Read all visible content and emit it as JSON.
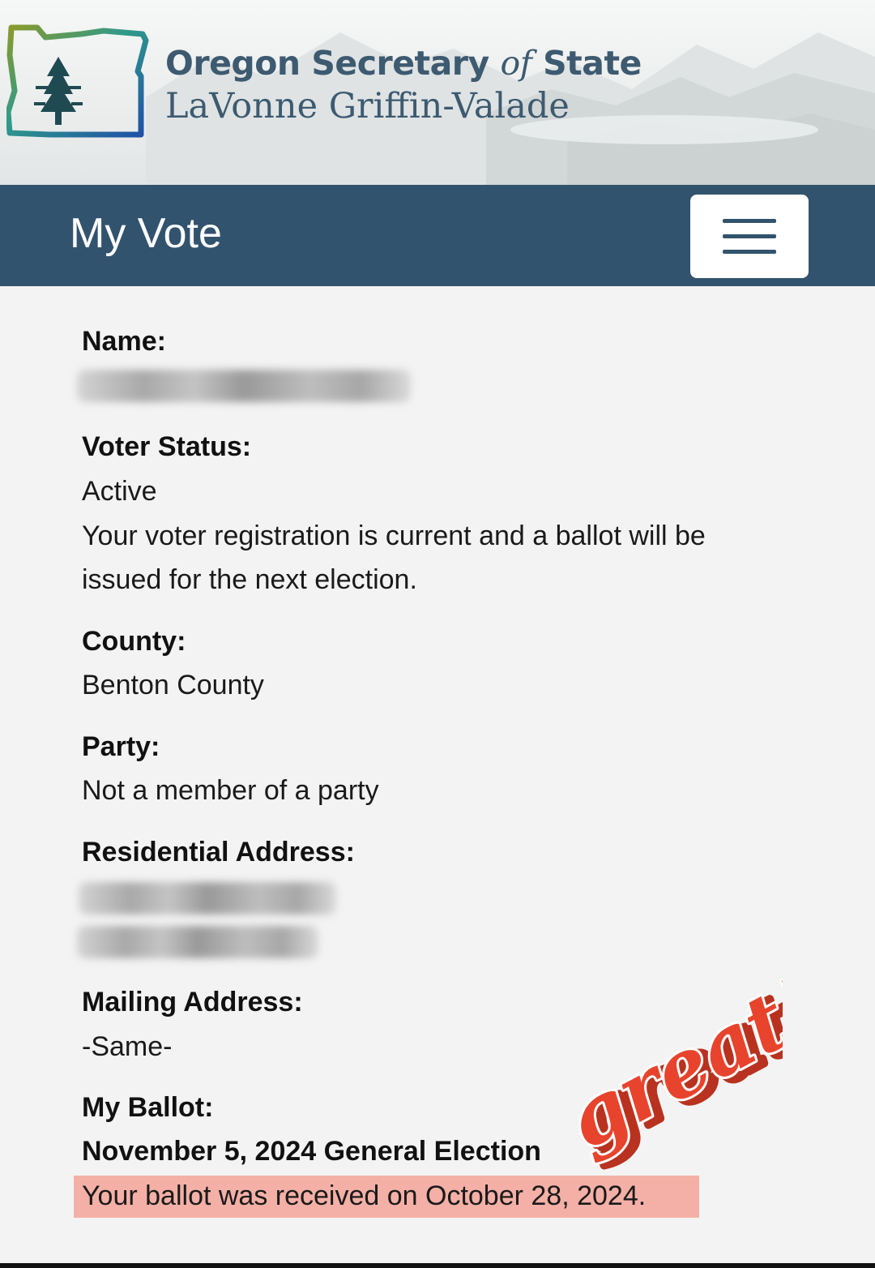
{
  "header": {
    "agency_main": "Oregon Secretary ",
    "agency_of": "of",
    "agency_end": " State",
    "official": "LaVonne Griffin-Valade",
    "logo_icon": "oregon-tree-logo-icon"
  },
  "navbar": {
    "title": "My Vote",
    "menu_icon": "hamburger-menu-icon"
  },
  "record": {
    "name_label": "Name:",
    "voter_status_label": "Voter Status:",
    "voter_status_value": "Active",
    "voter_status_desc_1": "Your voter registration is current and a ballot will be",
    "voter_status_desc_2": "issued for the next election.",
    "county_label": "County:",
    "county_value": "Benton County",
    "party_label": "Party:",
    "party_value": "Not a member of a party",
    "residential_label": "Residential Address:",
    "mailing_label": "Mailing Address:",
    "mailing_value": "-Same-",
    "ballot_label": "My Ballot:",
    "ballot_election": "November 5, 2024 General Election",
    "ballot_received": "Your ballot was received on October 28, 2024."
  },
  "sticker": {
    "text": "great!"
  },
  "colors": {
    "navbar": "#32536e",
    "brand_text": "#3d5a70",
    "highlight": "#f4b0a6",
    "sticker": "#e8432c"
  }
}
